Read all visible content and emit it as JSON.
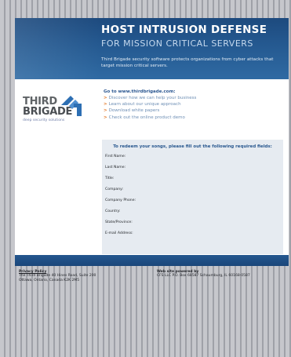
{
  "banner": {
    "title": "HOST INTRUSION DEFENSE",
    "subtitle": "FOR MISSION CRITICAL SERVERS",
    "description": "Third Brigade security software protects organizations from cyber attacks that target mission critical servers."
  },
  "logo": {
    "line1": "THIRD",
    "line2": "BRIGADE",
    "tagline": "deep security solutions",
    "colors": {
      "text": "#5f6366",
      "mark": "#2d6fb3",
      "tag": "#6f7ea8"
    }
  },
  "links": {
    "heading": "Go to www.thirdbrigade.com:",
    "items": [
      "Discover how we can help your business",
      "Learn about our unique approach",
      "Download white papers",
      "Check out the online product demo"
    ]
  },
  "form": {
    "heading": "To redeem your songs, please fill out the following required fields:",
    "fields": [
      "First Name:",
      "Last Name:",
      "Title:",
      "Company:",
      "Company Phone:",
      "Country:",
      "State/Province:",
      "E-mail Address:"
    ]
  },
  "footer": {
    "left": {
      "title": "Privacy Policy",
      "line1": "The Third Brigade 40 Hines Road, Suite 200",
      "line2": "Ottawa, Ontario, Canada K2K 2M5"
    },
    "right": {
      "title": "Web site powered by",
      "line1": "CFS LLC P.O. Box 68587 Schaumburg, IL 60168-0587"
    }
  },
  "colors": {
    "banner": "#24588f",
    "accent_arrow": "#e37b2b",
    "link": "#6e8fb5",
    "heading_blue": "#2a5690",
    "form_panel": "#e6ebf1",
    "page_stripes": "#c6c7cc"
  }
}
